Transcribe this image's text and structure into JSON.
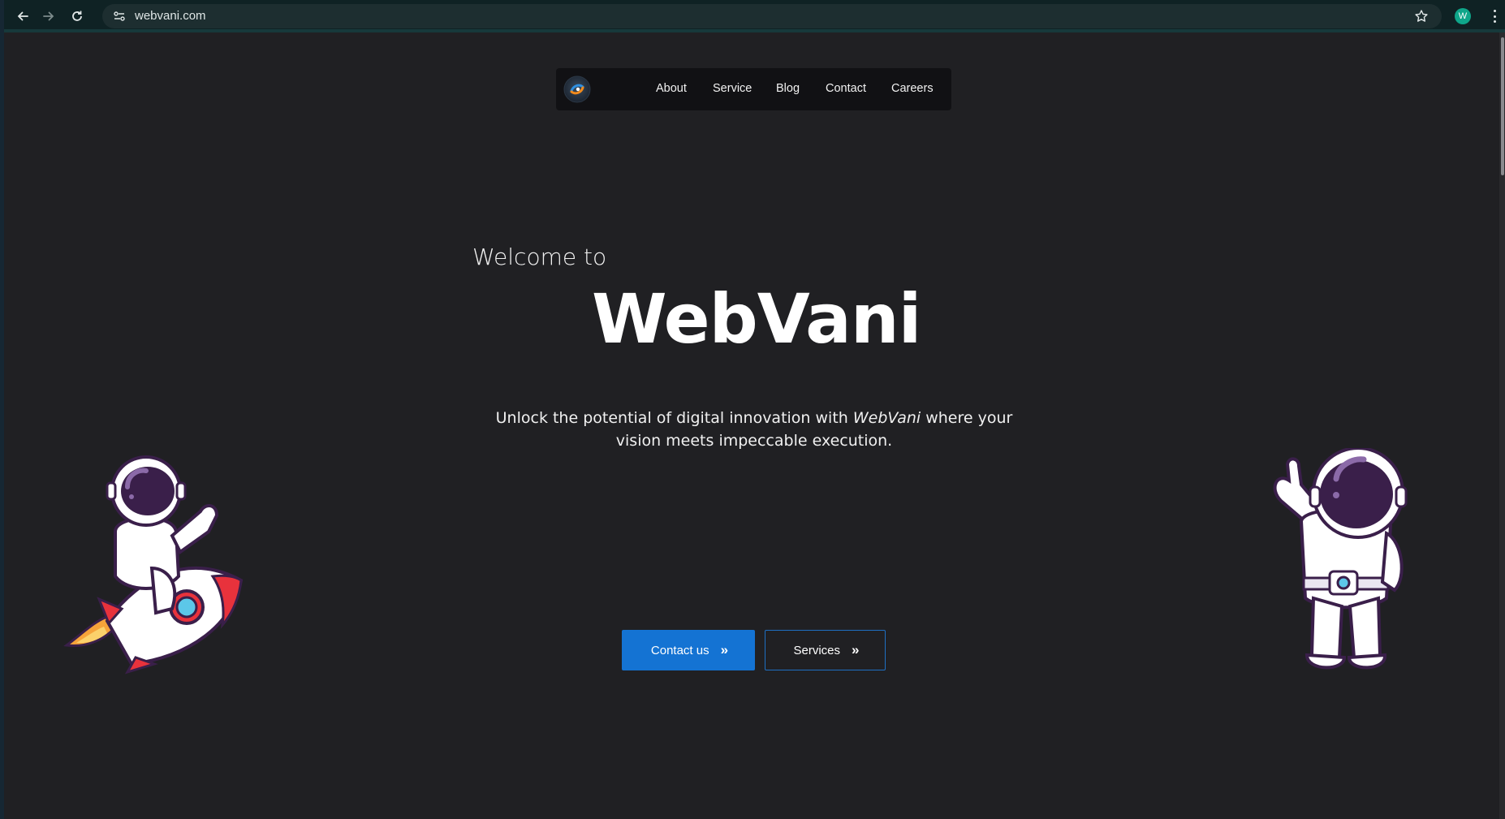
{
  "browser": {
    "url": "webvani.com",
    "profile_initial": "W",
    "icons": [
      "back-arrow-icon",
      "forward-arrow-icon",
      "reload-icon",
      "site-settings-icon",
      "bookmark-star-icon",
      "more-menu-icon"
    ]
  },
  "nav": {
    "logo_icon": "webvani-logo-icon",
    "links": [
      "About",
      "Service",
      "Blog",
      "Contact",
      "Careers"
    ]
  },
  "hero": {
    "welcome": "Welcome to",
    "title": "WebVani",
    "tagline_prefix": "Unlock the potential of digital innovation with",
    "tagline_brand": "WebVani",
    "tagline_suffix": "where your vision meets impeccable execution."
  },
  "buttons": {
    "primary_label": "Contact us",
    "secondary_label": "Services",
    "chevron": "»"
  },
  "colors": {
    "page_bg": "#202023",
    "nav_bg": "#111114",
    "primary": "#1473d3",
    "browser_bar": "#0f2224"
  }
}
